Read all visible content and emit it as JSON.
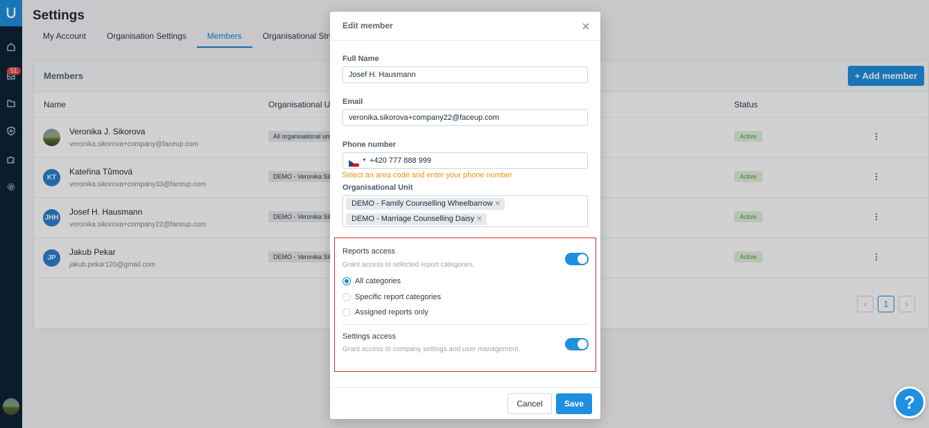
{
  "sidebar": {
    "logo": "u-logo-icon",
    "notification_count": "51",
    "icons": [
      "home-icon",
      "inbox-icon",
      "folder-icon",
      "shield-icon",
      "puzzle-icon",
      "gear-icon"
    ]
  },
  "page": {
    "title": "Settings",
    "tabs": [
      {
        "label": "My Account"
      },
      {
        "label": "Organisation Settings"
      },
      {
        "label": "Members",
        "active": true
      },
      {
        "label": "Organisational Structure"
      }
    ]
  },
  "members_card": {
    "title": "Members",
    "add_button": "+ Add member",
    "columns": {
      "name": "Name",
      "unit": "Organisational Unit",
      "status": "Status"
    },
    "rows": [
      {
        "initials": "",
        "name": "Veronika J. Sikorova",
        "email": "veronika.sikorova+company@faceup.com",
        "unit": "All organisational units",
        "status": "Active"
      },
      {
        "initials": "KT",
        "name": "Kateřina Tůmová",
        "email": "veronika.sikorova+company33@faceup.com",
        "unit": "DEMO - Veronika Sikorova",
        "status": "Active"
      },
      {
        "initials": "JHH",
        "name": "Josef H. Hausmann",
        "email": "veronika.sikorova+company22@faceup.com",
        "unit": "DEMO - Veronika Sikorova",
        "status": "Active"
      },
      {
        "initials": "JP",
        "name": "Jakub Pekar",
        "email": "jakub.pekar120@gmail.com",
        "unit": "DEMO - Veronika Sikorova",
        "status": "Active"
      }
    ],
    "pagination": {
      "prev": "‹",
      "current": "1",
      "next": "›"
    }
  },
  "modal": {
    "title": "Edit member",
    "full_name_label": "Full Name",
    "full_name_value": "Josef H. Hausmann",
    "email_label": "Email",
    "email_value": "veronika.sikorova+company22@faceup.com",
    "phone_label": "Phone number",
    "phone_value": "+420 777 888 999",
    "phone_hint": "Select an area code and enter your phone number",
    "unit_label": "Organisational Unit",
    "unit_tags": [
      "DEMO -  Family Counselling Wheelbarrow",
      "DEMO -  Marriage Counselling Daisy"
    ],
    "reports_access": {
      "title": "Reports access",
      "description": "Grant access to selected report categories.",
      "enabled": true,
      "options": [
        {
          "label": "All categories",
          "checked": true
        },
        {
          "label": "Specific report categories",
          "checked": false
        },
        {
          "label": "Assigned reports only",
          "checked": false
        }
      ]
    },
    "settings_access": {
      "title": "Settings access",
      "description": "Grant access to company settings and user management.",
      "enabled": true
    },
    "cancel_label": "Cancel",
    "save_label": "Save"
  },
  "help_button": "?",
  "colors": {
    "accent": "#1e90e0",
    "sidebar": "#0d2438",
    "highlight": "#d22d2d",
    "hint": "#e8920f"
  }
}
